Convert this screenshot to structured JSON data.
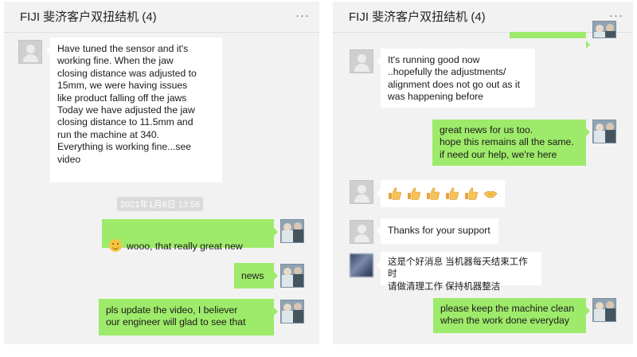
{
  "chat_title": "FIJI  斐济客户双扭结机 (4)",
  "more_glyph": "···",
  "left_panel": {
    "msg1": "Have tuned the sensor and it's\nworking fine. When the jaw\nclosing distance was adjusted to\n15mm, we were having issues\nlike product falling off the jaws\nToday we have adjusted the jaw\nclosing distance to 11.5mm and\nrun the machine at 340.\nEverything is working fine...see\nvideo",
    "timestamp": "2021年1月8日 13:56",
    "msg2": "wooo, that really great new",
    "msg3": "news",
    "msg4": "pls update the video, I believer\nour engineer will glad to see that"
  },
  "right_panel": {
    "msg1": "It's running good now\n..hopefully the adjustments/\nalignment does not go out as it\nwas happening before",
    "msg2": "great news for us too.\nhope this remains all the same.\nif need our help, we're here",
    "thumbs_count": 5,
    "msg4": "Thanks for your support",
    "msg5": "这是个好消息 当机器每天结束工作时\n 请做清理工作 保持机器整洁",
    "msg6": "please keep the machine clean\nwhen the work done everyday"
  },
  "colors": {
    "sent_bubble": "#9eea6a",
    "received_bubble": "#ffffff",
    "chat_background": "#f2f2f2"
  },
  "icons": [
    "default-avatar-icon",
    "photo-avatar-icon",
    "blurred-avatar-icon",
    "smile-emoji-icon",
    "thumbs-up-emoji-icon",
    "handshake-emoji-icon",
    "more-options-icon"
  ]
}
